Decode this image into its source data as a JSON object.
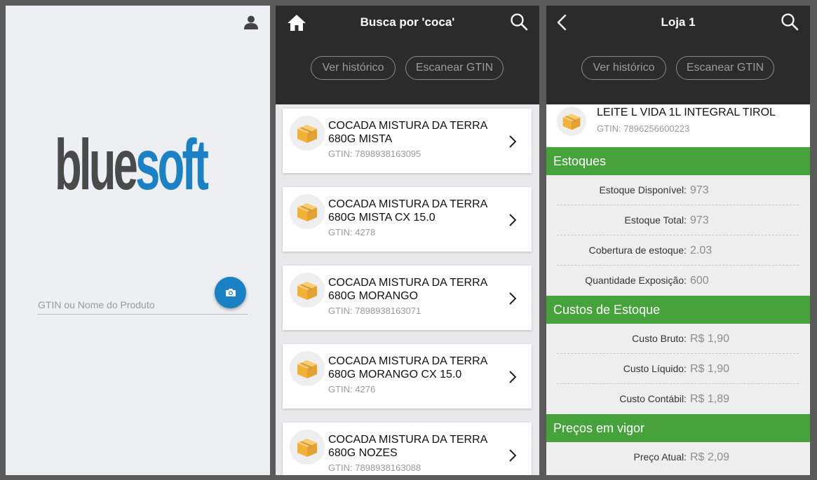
{
  "login": {
    "logo_left": "blue",
    "logo_right": "soft",
    "search_placeholder": "GTIN ou Nome do Produto",
    "icons": [
      "user-icon",
      "camera-icon"
    ],
    "colors": {
      "brand_blue": "#1a82c4",
      "logo_gray": "#4a4a4a"
    }
  },
  "search": {
    "title": "Busca por 'coca'",
    "history_label": "Ver histórico",
    "scan_label": "Escanear GTIN",
    "results": [
      {
        "name": "COCADA MISTURA DA TERRA 680G MISTA",
        "gtin": "GTIN: 7898938163095"
      },
      {
        "name": "COCADA MISTURA DA TERRA 680G MISTA CX 15.0",
        "gtin": "GTIN: 4278"
      },
      {
        "name": "COCADA MISTURA DA TERRA 680G MORANGO",
        "gtin": "GTIN: 7898938163071"
      },
      {
        "name": "COCADA MISTURA DA TERRA 680G MORANGO CX 15.0",
        "gtin": "GTIN: 4276"
      },
      {
        "name": "COCADA MISTURA DA TERRA 680G NOZES",
        "gtin": "GTIN: 7898938163088"
      }
    ]
  },
  "store": {
    "title": "Loja 1",
    "history_label": "Ver histórico",
    "scan_label": "Escanear GTIN",
    "product": {
      "name": "LEITE L VIDA 1L INTEGRAL TIROL",
      "gtin": "GTIN: 7896256600223"
    },
    "stock_title": "Estoques",
    "stock": [
      {
        "label": "Estoque Disponível:",
        "value": "973"
      },
      {
        "label": "Estoque Total:",
        "value": "973"
      },
      {
        "label": "Cobertura de estoque:",
        "value": "2.03"
      },
      {
        "label": "Quantidade Exposição:",
        "value": "600"
      }
    ],
    "costs_title": "Custos de Estoque",
    "costs": [
      {
        "label": "Custo Bruto:",
        "value": "R$ 1,90"
      },
      {
        "label": "Custo Líquido:",
        "value": "R$ 1,90"
      },
      {
        "label": "Custo Contábil:",
        "value": "R$ 1,89"
      }
    ],
    "prices_title": "Preços em vigor",
    "prices": [
      {
        "label": "Preço Atual:",
        "value": "R$ 2,09"
      }
    ],
    "colors": {
      "section_green": "#46a23a",
      "header_dark": "#2b2b2b"
    }
  }
}
